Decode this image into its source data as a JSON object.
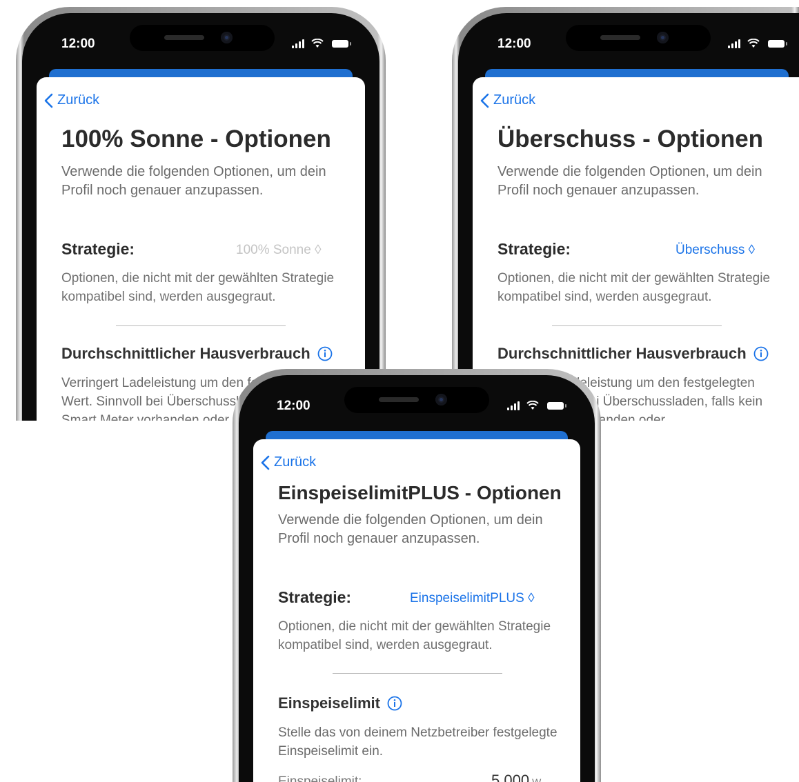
{
  "status_time": "12:00",
  "back_label": "Zurück",
  "subtitle": "Verwende die folgenden Optionen, um dein Profil noch genauer anzupassen.",
  "strategy_label": "Strategie:",
  "hint": "Optionen, die nicht mit der gewählten Strategie kompatibel sind, werden ausgegraut.",
  "phones": [
    {
      "title": "100% Sonne - Optionen",
      "strategy_value": "100% Sonne ◊",
      "strategy_value_color": "#c4c4c4",
      "section_title": "Durchschnittlicher Hausverbrauch",
      "section_text": "Verringert Ladeleistung um den festgelegten Wert. Sinnvoll bei Überschussladen, falls kein Smart Meter vorhanden oder"
    },
    {
      "title": "Überschuss - Optionen",
      "strategy_value": "Überschuss ◊",
      "strategy_value_color": "#1a73e8",
      "section_title": "Durchschnittlicher Hausverbrauch",
      "section_text": "Verringert Ladeleistung um den festgelegten Wert. Sinnvoll bei Überschussladen, falls kein Smart Meter vorhanden oder"
    },
    {
      "title": "EinspeiselimitPLUS - Optionen",
      "strategy_value": "EinspeiselimitPLUS ◊",
      "strategy_value_color": "#1a73e8",
      "section_title": "Einspeiselimit",
      "section_text": "Stelle das von deinem Netzbetreiber festgelegte Einspeiselimit ein.",
      "row_label": "Einspeiselimit:",
      "row_value": "5.000",
      "row_unit": "W"
    }
  ]
}
